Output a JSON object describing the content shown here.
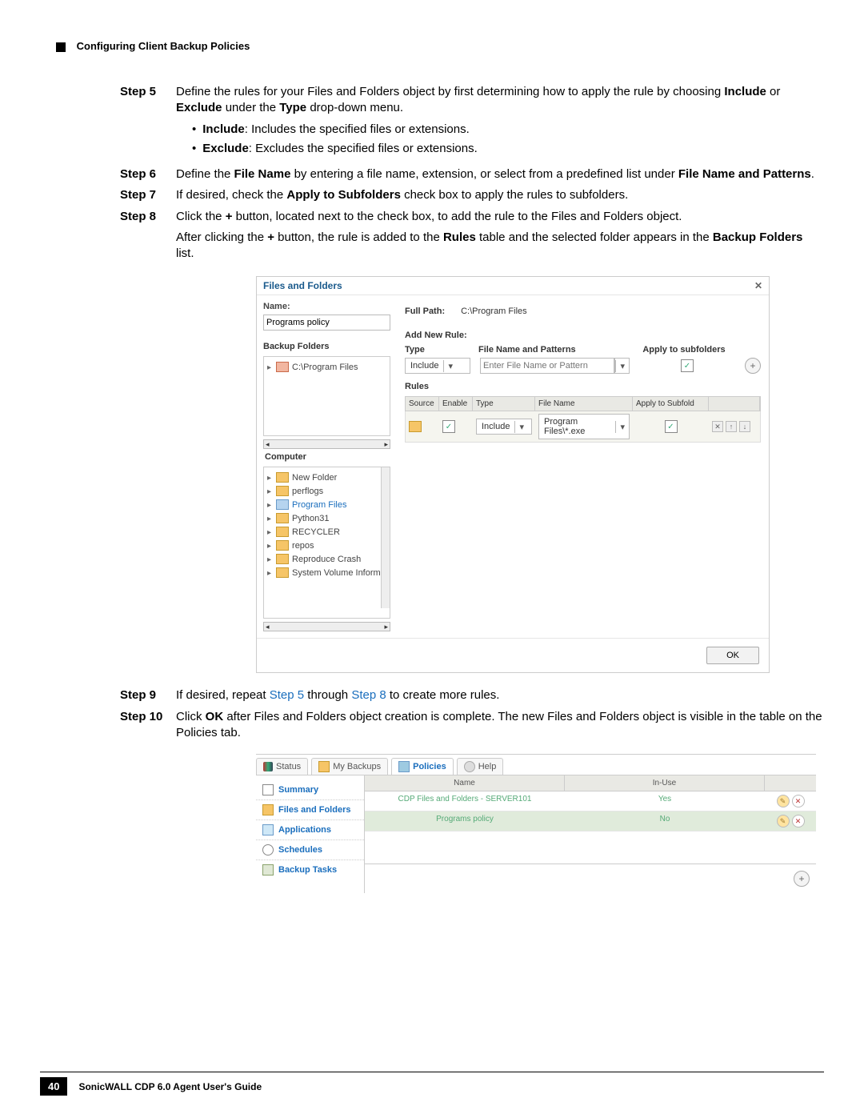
{
  "header": {
    "title": "Configuring Client Backup Policies"
  },
  "steps": {
    "s5": {
      "label": "Step 5",
      "text_pre": "Define the rules for your Files and Folders object by first determining how to apply the rule by choosing ",
      "include": "Include",
      "or": " or ",
      "exclude": "Exclude",
      "under": " under the ",
      "type": "Type",
      "tail": " drop-down menu."
    },
    "bullets": {
      "inc_b": "Include",
      "inc_t": ": Includes the specified files or extensions.",
      "exc_b": "Exclude",
      "exc_t": ": Excludes the specified files or extensions."
    },
    "s6": {
      "label": "Step 6",
      "t1": "Define the ",
      "b1": "File Name",
      "t2": " by entering a file name, extension, or select from a predefined list under ",
      "b2": "File Name and Patterns",
      "t3": "."
    },
    "s7": {
      "label": "Step 7",
      "t1": "If desired, check the ",
      "b1": "Apply to Subfolders",
      "t2": " check box to apply the rules to subfolders."
    },
    "s8": {
      "label": "Step 8",
      "t1": "Click the ",
      "b1": "+",
      "t2": " button, located next to the check box, to add the rule to the Files and Folders object.",
      "t3": "After clicking the ",
      "b2": "+",
      "t4": " button, the rule is added to the ",
      "b3": "Rules",
      "t5": " table and the selected folder appears in the ",
      "b4": "Backup Folders",
      "t6": " list."
    },
    "s9": {
      "label": "Step 9",
      "t1": "If desired, repeat ",
      "l1": "Step 5",
      "t2": " through ",
      "l2": "Step 8",
      "t3": " to create more rules."
    },
    "s10": {
      "label": "Step 10",
      "t1": "Click ",
      "b1": "OK",
      "t2": " after Files and Folders object creation is complete. The new Files and Folders object is visible in the table on the Policies tab."
    }
  },
  "dialog1": {
    "title": "Files and Folders",
    "name_label": "Name:",
    "name_value": "Programs policy",
    "backup_folders_label": "Backup Folders",
    "backup_folder_item": "C:\\Program Files",
    "fullpath_label": "Full Path:",
    "fullpath_value": "C:\\Program Files",
    "addnew_label": "Add New Rule:",
    "hdr_type": "Type",
    "hdr_pattern": "File Name and Patterns",
    "hdr_sub": "Apply to subfolders",
    "type_value": "Include",
    "pattern_placeholder": "Enter File Name or Pattern",
    "rules_label": "Rules",
    "rules_hdr": {
      "src": "Source",
      "en": "Enable",
      "type": "Type",
      "file": "File Name",
      "sub": "Apply to Subfold"
    },
    "rules_row": {
      "type": "Include",
      "file": "Program Files\\*.exe"
    },
    "computer_label": "Computer",
    "tree": [
      "New Folder",
      "perflogs",
      "Program Files",
      "Python31",
      "RECYCLER",
      "repos",
      "Reproduce Crash",
      "System Volume Inform..."
    ],
    "ok": "OK"
  },
  "dialog2": {
    "tabs": {
      "status": "Status",
      "mybackups": "My Backups",
      "policies": "Policies",
      "help": "Help"
    },
    "side": {
      "summary": "Summary",
      "ff": "Files and Folders",
      "apps": "Applications",
      "sched": "Schedules",
      "bt": "Backup Tasks"
    },
    "hdr": {
      "name": "Name",
      "inuse": "In-Use"
    },
    "rows": [
      {
        "name": "CDP Files and Folders - SERVER101",
        "inuse": "Yes"
      },
      {
        "name": "Programs policy",
        "inuse": "No"
      }
    ]
  },
  "footer": {
    "page_no": "40",
    "guide": "SonicWALL CDP 6.0 Agent User's Guide"
  }
}
